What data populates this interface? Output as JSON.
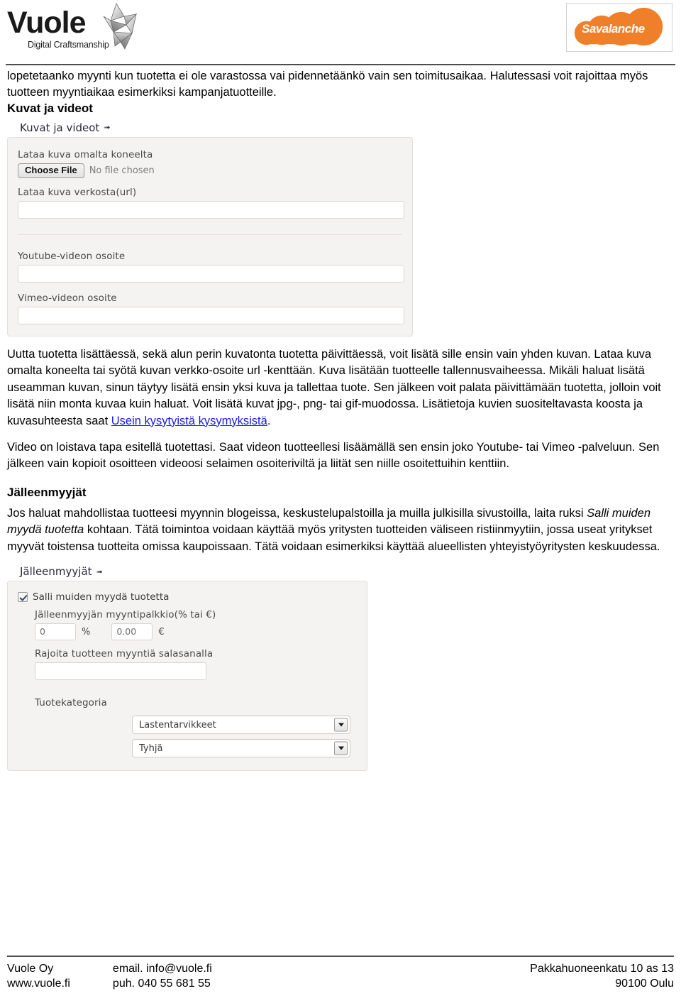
{
  "header": {
    "logo_primary": {
      "wordmark": "Vuole",
      "tagline": "Digital Craftsmanship",
      "icon": "origami-bird-icon"
    },
    "logo_secondary": {
      "text": "Savalanche",
      "brand_color": "#F07F2A"
    }
  },
  "document": {
    "intro_paragraph": "lopetetaanko myynti kun tuotetta ei ole varastossa vai pidennetäänkö vain sen toimitusaikaa. Halutessasi voit rajoittaa myös tuotteen myyntiaikaa esimerkiksi kampanjatuotteille.",
    "section_images": {
      "title": "Kuvat ja videot",
      "paragraph_1_part_1": "Uutta tuotetta lisättäessä, sekä alun perin kuvatonta tuotetta päivittäessä, voit lisätä sille ensin vain yhden kuvan. Lataa kuva omalta koneelta tai syötä kuvan verkko-osoite url -kenttään. Kuva lisätään tuotteelle tallennusvaiheessa. Mikäli haluat lisätä useamman kuvan, sinun täytyy lisätä ensin yksi kuva ja tallettaa tuote. Sen jälkeen voit palata päivittämään tuotetta, jolloin voit lisätä niin monta kuvaa kuin haluat. Voit lisätä kuvat jpg-, png- tai gif-muodossa. Lisätietoja kuvien suositeltavasta koosta ja kuvasuhteesta saat ",
      "paragraph_1_link": "Usein kysytyistä kysymyksistä",
      "paragraph_1_part_2": ".",
      "paragraph_2": "Video on loistava tapa esitellä tuotettasi. Saat videon tuotteellesi lisäämällä sen ensin joko Youtube- tai Vimeo -palveluun. Sen jälkeen vain kopioit osoitteen videoosi selaimen osoiteriviltä ja liität sen niille osoitettuihin kenttiin."
    },
    "section_resellers": {
      "title": "Jälleenmyyjät",
      "paragraph_part_1": "Jos haluat mahdollistaa tuotteesi myynnin blogeissa, keskustelupalstoilla ja muilla julkisilla sivustoilla, laita ruksi ",
      "paragraph_emphasis": "Salli muiden myydä tuotetta",
      "paragraph_part_2": " kohtaan. Tätä toimintoa voidaan käyttää myös yritysten tuotteiden väliseen ristiinmyytiin, jossa useat yritykset myyvät toistensa tuotteita omissa kaupoissaan. Tätä voidaan esimerkiksi käyttää alueellisten yhteyistyöyritysten keskuudessa."
    }
  },
  "media_panel": {
    "heading": "Kuvat ja videot",
    "chevron": "chevron-down-icon",
    "upload_local_label": "Lataa kuva omalta koneelta",
    "choose_file_button": "Choose File",
    "no_file_text": "No file chosen",
    "upload_url_label": "Lataa kuva verkosta(url)",
    "upload_url_value": "",
    "youtube_label": "Youtube-videon osoite",
    "youtube_value": "",
    "vimeo_label": "Vimeo-videon osoite",
    "vimeo_value": ""
  },
  "reseller_panel": {
    "heading": "Jälleenmyyjät",
    "chevron": "chevron-down-icon",
    "allow_checkbox_label": "Salli muiden myydä tuotetta",
    "allow_checkbox_checked": true,
    "commission_label": "Jälleenmyyjän myyntipalkkio(% tai €)",
    "commission_percent_value": "0",
    "commission_percent_unit": "%",
    "commission_euro_value": "0.00",
    "commission_euro_unit": "€",
    "password_label": "Rajoita tuotteen myyntiä salasanalla",
    "password_value": "",
    "category_label": "Tuotekategoria",
    "category_select_1_value": "Lastentarvikkeet",
    "category_select_2_value": "Tyhjä"
  },
  "footer": {
    "company_name": "Vuole Oy",
    "website": "www.vuole.fi",
    "email": "email. info@vuole.fi",
    "phone": "puh. 040 55 681 55",
    "address_line_1": "Pakkahuoneenkatu 10 as 13",
    "address_line_2": "90100 Oulu"
  }
}
